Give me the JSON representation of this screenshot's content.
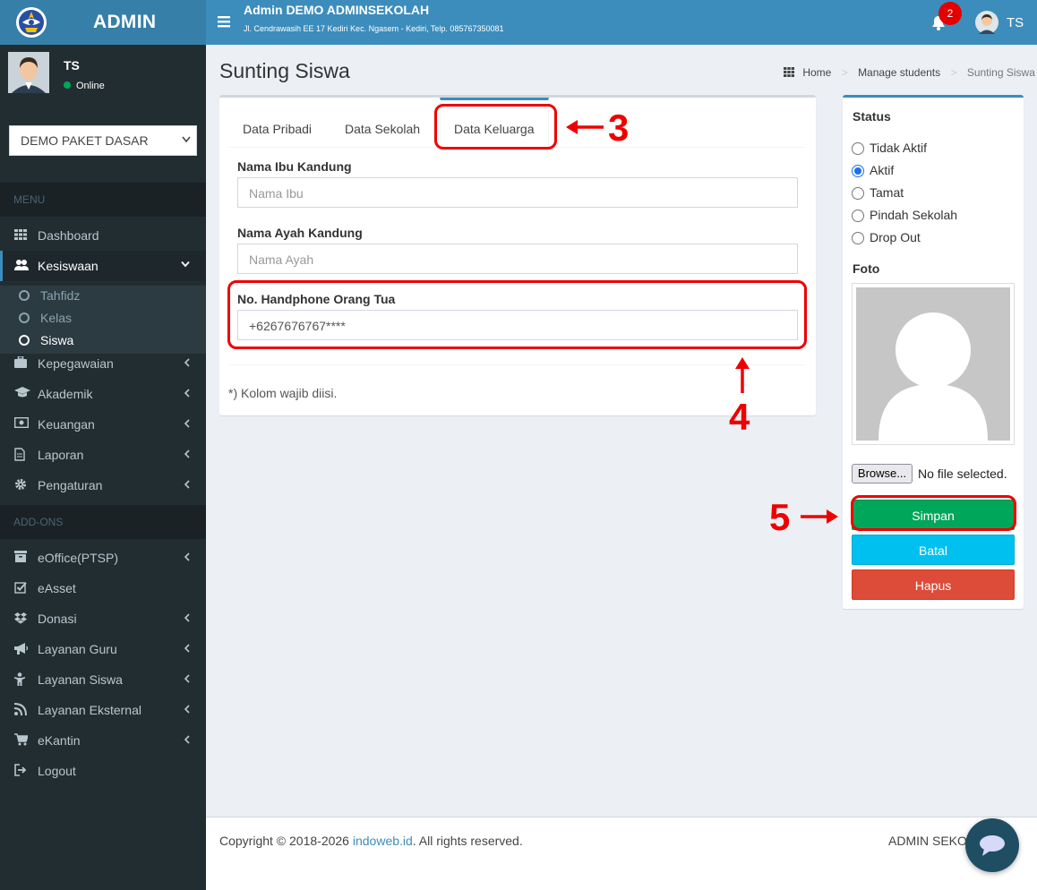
{
  "header": {
    "logo_text": "ADMIN",
    "school_name": "Admin DEMO ADMINSEKOLAH",
    "school_address": "Jl. Cendrawasih EE 17 Kediri Kec. Ngasem - Kediri, Telp. 085767350081",
    "notification_count": "2",
    "user_initials": "TS"
  },
  "sidebar": {
    "user_name": "TS",
    "user_status": "Online",
    "school_select": "DEMO PAKET DASAR",
    "menu_header": "MENU",
    "addons_header": "ADD-ONS",
    "items": [
      {
        "label": "Dashboard",
        "icon": "grid-icon"
      },
      {
        "label": "Kesiswaan",
        "icon": "users-icon"
      },
      {
        "label": "Kepegawaian",
        "icon": "briefcase-icon"
      },
      {
        "label": "Akademik",
        "icon": "graduation-cap-icon"
      },
      {
        "label": "Keuangan",
        "icon": "money-icon"
      },
      {
        "label": "Laporan",
        "icon": "document-icon"
      },
      {
        "label": "Pengaturan",
        "icon": "gear-icon"
      }
    ],
    "submenu": [
      {
        "label": "Tahfidz"
      },
      {
        "label": "Kelas"
      },
      {
        "label": "Siswa"
      }
    ],
    "addons": [
      {
        "label": "eOffice(PTSP)",
        "icon": "archive-icon"
      },
      {
        "label": "eAsset",
        "icon": "check-square-icon"
      },
      {
        "label": "Donasi",
        "icon": "dropbox-icon"
      },
      {
        "label": "Layanan Guru",
        "icon": "megaphone-icon"
      },
      {
        "label": "Layanan Siswa",
        "icon": "child-icon"
      },
      {
        "label": "Layanan Eksternal",
        "icon": "rss-icon"
      },
      {
        "label": "eKantin",
        "icon": "cart-icon"
      },
      {
        "label": "Logout",
        "icon": "sign-out-icon"
      }
    ]
  },
  "page": {
    "title": "Sunting Siswa",
    "breadcrumb": [
      "Home",
      "Manage students",
      "Sunting Siswa"
    ]
  },
  "form": {
    "tabs": [
      "Data Pribadi",
      "Data Sekolah",
      "Data Keluarga"
    ],
    "active_tab": "Data Keluarga",
    "fields": [
      {
        "label": "Nama Ibu Kandung",
        "value": "",
        "placeholder": "Nama Ibu"
      },
      {
        "label": "Nama Ayah Kandung",
        "value": "",
        "placeholder": "Nama Ayah"
      },
      {
        "label": "No. Handphone Orang Tua",
        "value": "+6267676767****",
        "placeholder": ""
      }
    ],
    "required_note": "*) Kolom wajib diisi."
  },
  "status_panel": {
    "title": "Status",
    "options": [
      "Tidak Aktif",
      "Aktif",
      "Tamat",
      "Pindah Sekolah",
      "Drop Out"
    ],
    "selected": "Aktif",
    "photo_title": "Foto",
    "browse_label": "Browse...",
    "file_status": "No file selected.",
    "save_label": "Simpan",
    "cancel_label": "Batal",
    "delete_label": "Hapus"
  },
  "annotations": [
    "3",
    "4",
    "5"
  ],
  "footer": {
    "copyright_prefix": "Copyright © 2018-2026 ",
    "copyright_link": "indoweb.id",
    "copyright_suffix": ". All rights reserved.",
    "version": "ADMIN SEKOLAH v2.0"
  },
  "colors": {
    "topbar": "#3c8dbc",
    "logo_bg": "#367fa9",
    "sidebar": "#222d32",
    "save": "#00a65a",
    "cancel": "#00c0ef",
    "delete": "#dd4b39",
    "annotation": "#ee0000"
  }
}
